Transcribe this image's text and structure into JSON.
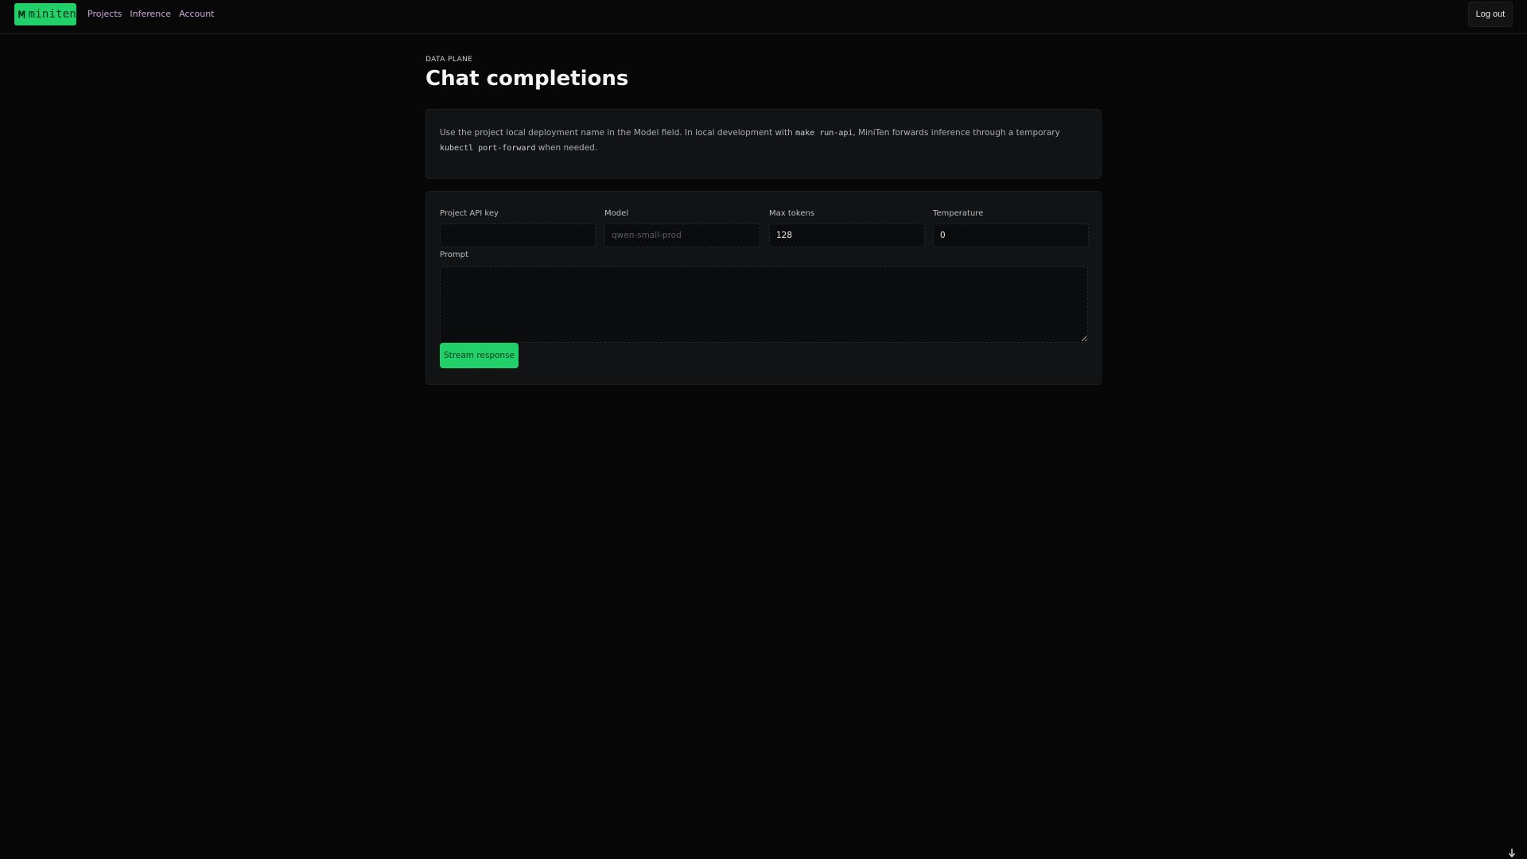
{
  "brand": {
    "logo_text": "miniten",
    "accent_color": "#22d06a"
  },
  "nav": {
    "items": [
      {
        "label": "Projects"
      },
      {
        "label": "Inference"
      },
      {
        "label": "Account"
      }
    ],
    "logout_label": "Log out"
  },
  "page": {
    "eyebrow": "DATA PLANE",
    "title": "Chat completions"
  },
  "note": {
    "part1": "Use the project local deployment name in the Model field. In local development with ",
    "code1": "make run-api",
    "part2": ", MiniTen forwards inference through a temporary ",
    "code2": "kubectl port-forward",
    "part3": " when needed."
  },
  "form": {
    "api_key": {
      "label": "Project API key",
      "value": "",
      "placeholder": ""
    },
    "model": {
      "label": "Model",
      "value": "",
      "placeholder": "qwen-small-prod"
    },
    "max_tokens": {
      "label": "Max tokens",
      "value": "128"
    },
    "temperature": {
      "label": "Temperature",
      "value": "0"
    },
    "prompt": {
      "label": "Prompt",
      "value": ""
    },
    "submit_label": "Stream response"
  },
  "icons": {
    "logo": "miniten-logo-icon",
    "corner": "arrow-down-icon"
  }
}
